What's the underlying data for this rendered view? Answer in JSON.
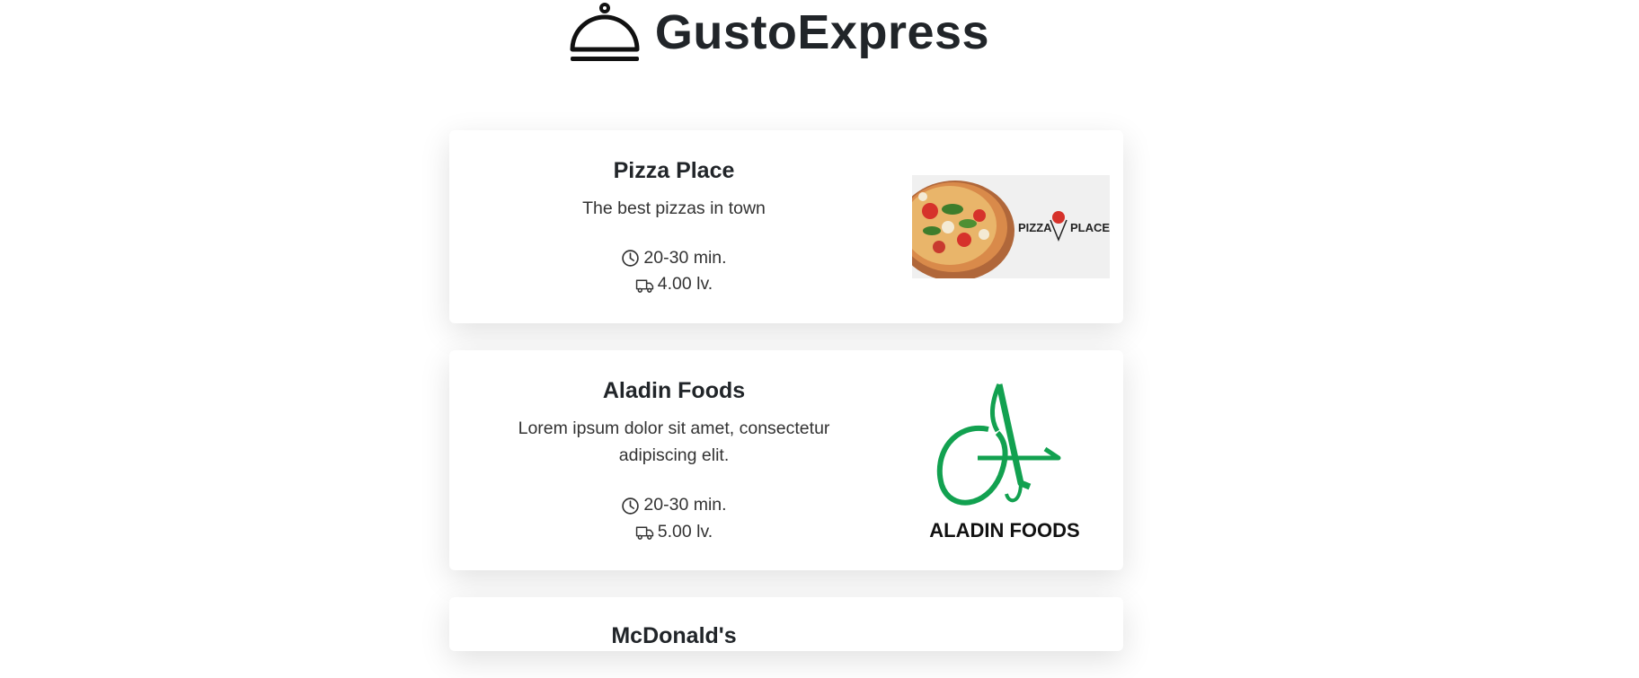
{
  "header": {
    "brand": "GustoExpress",
    "icon": "cloche-icon"
  },
  "restaurants": [
    {
      "name": "Pizza Place",
      "description": "The best pizzas in town",
      "time": "20-30 min.",
      "delivery": "4.00 lv.",
      "logo_text_left": "PIZZA",
      "logo_text_right": "PLACE"
    },
    {
      "name": "Aladin Foods",
      "description": "Lorem ipsum dolor sit amet, consectetur adipiscing elit.",
      "time": "20-30 min.",
      "delivery": "5.00 lv.",
      "logo_text": "ALADIN FOODS",
      "accent": "#12a150"
    },
    {
      "name": "McDonald's"
    }
  ]
}
